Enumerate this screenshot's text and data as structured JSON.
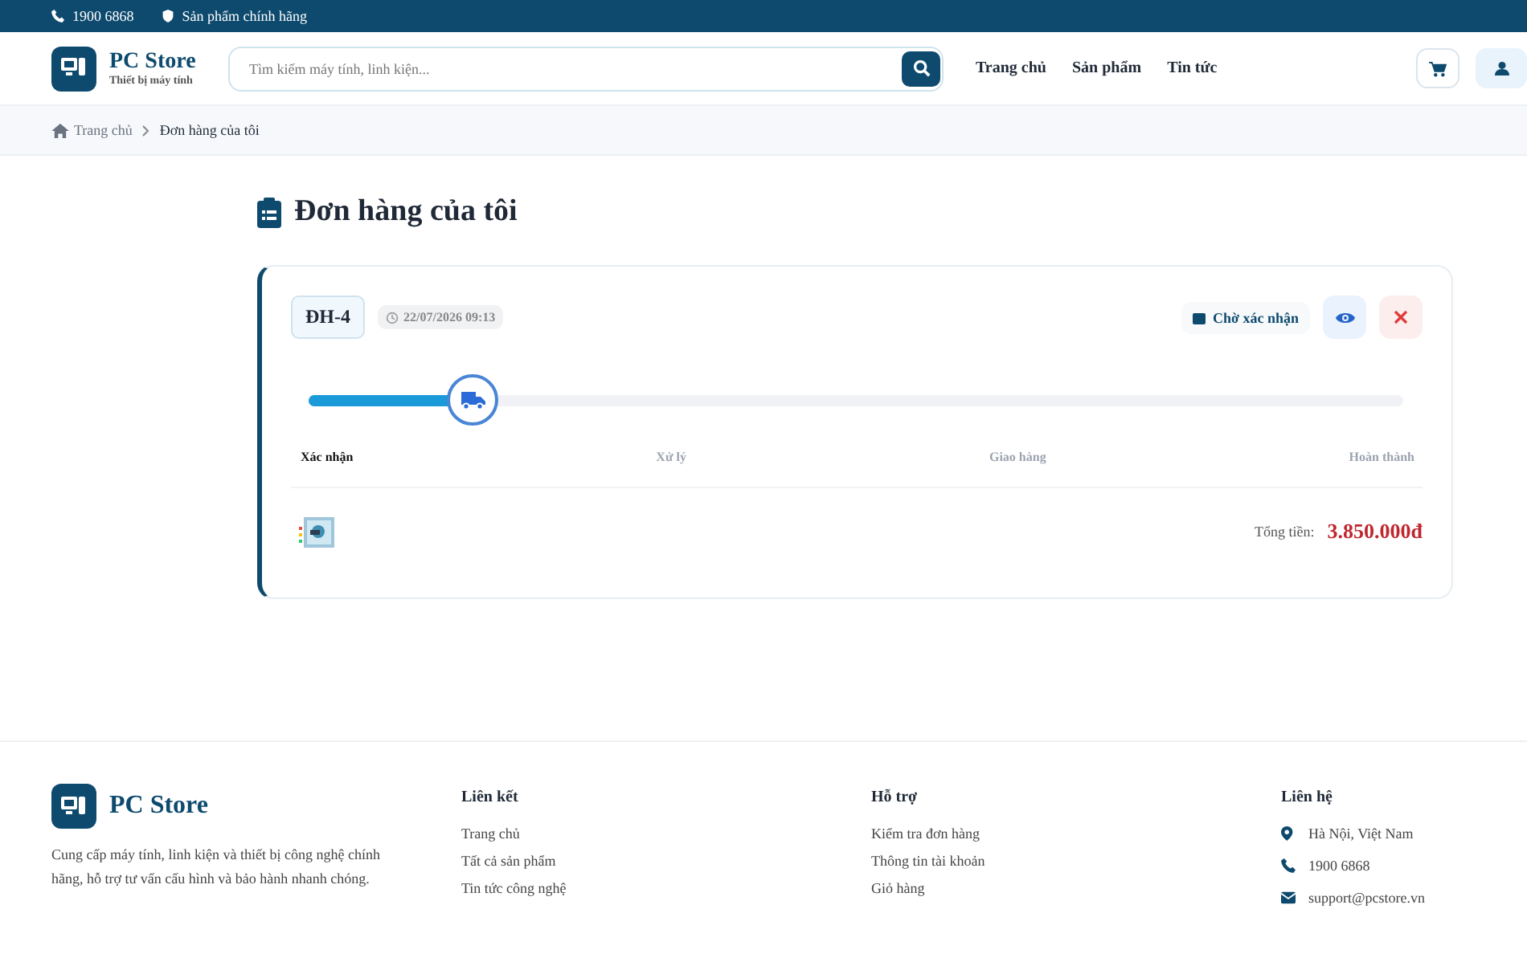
{
  "topbar": {
    "phone": "1900 6868",
    "note": "Sản phẩm chính hãng"
  },
  "brand": {
    "name": "PC Store",
    "tagline": "Thiết bị máy tính"
  },
  "search": {
    "placeholder": "Tìm kiếm máy tính, linh kiện..."
  },
  "nav": [
    "Trang chủ",
    "Sản phẩm",
    "Tin tức"
  ],
  "breadcrumb": [
    "Trang chủ",
    "Đơn hàng của tôi"
  ],
  "page_title": "Đơn hàng của tôi",
  "order": {
    "code": "ĐH-4",
    "time": "22/07/2026 09:13",
    "status": "Chờ xác nhận",
    "level": 0.15,
    "steps": [
      {
        "label": "Xác nhận",
        "done": true
      },
      {
        "label": "Xử lý",
        "done": false
      },
      {
        "label": "Giao hàng",
        "done": false
      },
      {
        "label": "Hoàn thành",
        "done": false
      }
    ],
    "total_label": "Tổng tiền:",
    "total": "3.850.000đ"
  },
  "footer": {
    "brand": "PC Store",
    "about": "Cung cấp máy tính, linh kiện và thiết bị công nghệ chính hãng, hỗ trợ tư vấn cấu hình và bảo hành nhanh chóng.",
    "columns": [
      {
        "title": "Liên kết",
        "links": [
          "Trang chủ",
          "Tất cả sản phẩm",
          "Tin tức công nghệ"
        ]
      },
      {
        "title": "Hỗ trợ",
        "links": [
          "Kiểm tra đơn hàng",
          "Thông tin tài khoản",
          "Giỏ hàng"
        ]
      }
    ],
    "contact_title": "Liên hệ",
    "contacts": [
      {
        "kind": "address",
        "text": "Hà Nội, Việt Nam"
      },
      {
        "kind": "phone",
        "text": "1900 6868"
      },
      {
        "kind": "email",
        "text": "support@pcstore.vn"
      }
    ]
  }
}
